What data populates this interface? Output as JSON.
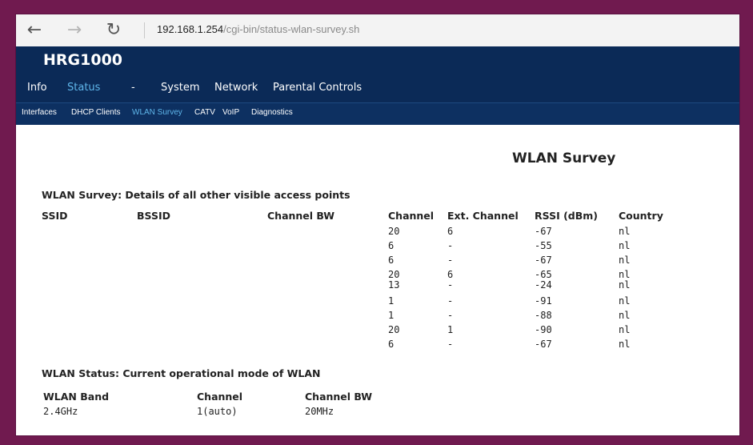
{
  "browser": {
    "back_icon": "←",
    "forward_icon": "→",
    "refresh_icon": "↻",
    "url_host": "192.168.1.254",
    "url_path": "/cgi-bin/status-wlan-survey.sh"
  },
  "brand": "HRG1000",
  "main_nav": [
    "Info",
    "Status",
    "-",
    "System",
    "Network",
    "Parental Controls"
  ],
  "sub_nav": [
    "Interfaces",
    "DHCP Clients",
    "WLAN Survey",
    "CATV",
    "VoIP",
    "Diagnostics"
  ],
  "page_title": "WLAN Survey",
  "survey": {
    "title": "WLAN Survey: Details of all other visible access points",
    "headers": [
      "SSID",
      "BSSID",
      "Channel BW",
      "Channel",
      "Ext. Channel",
      "RSSI (dBm)",
      "Country"
    ],
    "rows": [
      {
        "channel": "20",
        "ext": "6",
        "rssi": "-67",
        "country": "nl"
      },
      {
        "channel": "6",
        "ext": "-",
        "rssi": "-55",
        "country": "nl"
      },
      {
        "channel": "6",
        "ext": "-",
        "rssi": "-67",
        "country": "nl"
      },
      {
        "channel": "20",
        "ext": "6",
        "rssi": "-65",
        "country": "nl"
      },
      {
        "channel": "13",
        "ext": "-",
        "rssi": "-24",
        "country": "nl"
      },
      {
        "channel": "1",
        "ext": "-",
        "rssi": "-91",
        "country": "nl"
      },
      {
        "channel": "1",
        "ext": "-",
        "rssi": "-88",
        "country": "nl"
      },
      {
        "channel": "20",
        "ext": "1",
        "rssi": "-90",
        "country": "nl"
      },
      {
        "channel": "6",
        "ext": "-",
        "rssi": "-67",
        "country": "nl"
      }
    ]
  },
  "status": {
    "title": "WLAN Status: Current operational mode of WLAN",
    "headers": [
      "WLAN Band",
      "Channel",
      "Channel BW"
    ],
    "values": [
      "2.4GHz",
      "1(auto)",
      "20MHz"
    ]
  }
}
